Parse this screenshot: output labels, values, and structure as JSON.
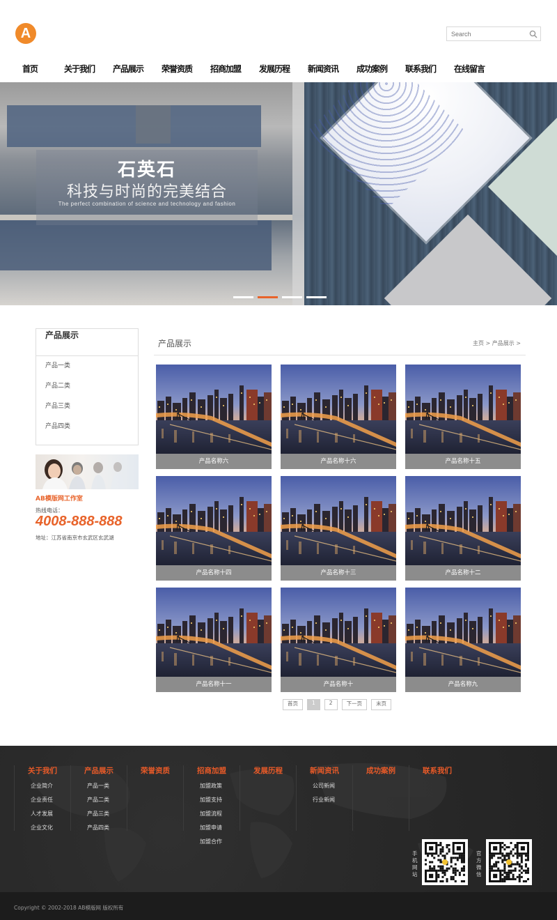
{
  "header": {
    "logo_letter": "A",
    "search_placeholder": "Search"
  },
  "nav": [
    "首页",
    "关于我们",
    "产品展示",
    "荣誉资质",
    "招商加盟",
    "发展历程",
    "新闻资讯",
    "成功案例",
    "联系我们",
    "在线留言"
  ],
  "banner": {
    "title": "石英石",
    "subtitle": "科技与时尚的完美结合",
    "english": "The perfect combination of science and technology and fashion",
    "slides": 4,
    "active_slide": 2
  },
  "sidebar": {
    "title": "产品展示",
    "items": [
      "产品一类",
      "产品二类",
      "产品三类",
      "产品四类"
    ],
    "contact": {
      "company": "AB模版网工作室",
      "hotline_label": "热线电话：",
      "phone": "4008-888-888",
      "address": "地址：江苏省南京市玄武区玄武湖"
    }
  },
  "main": {
    "title": "产品展示",
    "breadcrumb": "主页 > 产品展示 >",
    "products": [
      "产品名称六",
      "产品名称十六",
      "产品名称十五",
      "产品名称十四",
      "产品名称十三",
      "产品名称十二",
      "产品名称十一",
      "产品名称十",
      "产品名称九"
    ]
  },
  "pagination": {
    "first": "首页",
    "pages": [
      "1",
      "2"
    ],
    "current": "1",
    "next": "下一页",
    "last": "末页"
  },
  "footer": {
    "columns": [
      {
        "title": "关于我们",
        "items": [
          "企业简介",
          "企业责任",
          "人才发展",
          "企业文化"
        ]
      },
      {
        "title": "产品展示",
        "items": [
          "产品一类",
          "产品二类",
          "产品三类",
          "产品四类"
        ]
      },
      {
        "title": "荣誉资质",
        "items": []
      },
      {
        "title": "招商加盟",
        "items": [
          "加盟政策",
          "加盟支持",
          "加盟流程",
          "加盟申请",
          "加盟合作"
        ]
      },
      {
        "title": "发展历程",
        "items": []
      },
      {
        "title": "新闻资讯",
        "items": [
          "公司新闻",
          "行业新闻"
        ]
      },
      {
        "title": "成功案例",
        "items": []
      },
      {
        "title": "联系我们",
        "items": []
      }
    ],
    "qr_codes": [
      "手机网站",
      "官方微信"
    ],
    "copyright": "Copyright © 2002-2018 AB模版网 版权所有"
  },
  "colors": {
    "accent": "#e8632a",
    "logo": "#f08a2a",
    "caption_bg": "#8c8c8c",
    "footer_bg": "#2a2a2a"
  }
}
